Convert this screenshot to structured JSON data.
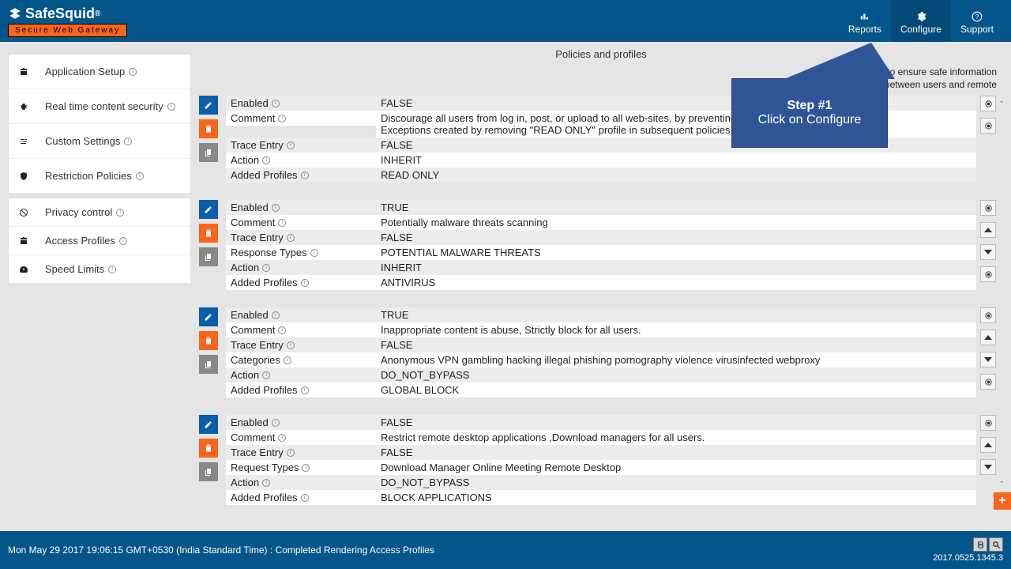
{
  "header": {
    "brand_main": "SafeSquid",
    "brand_reg": "®",
    "brand_tag": "Secure Web Gateway",
    "nav": [
      {
        "id": "reports",
        "label": "Reports"
      },
      {
        "id": "configure",
        "label": "Configure"
      },
      {
        "id": "support",
        "label": "Support"
      }
    ]
  },
  "sidebar": {
    "items": [
      {
        "id": "app-setup",
        "label": "Application Setup",
        "icon": "briefcase"
      },
      {
        "id": "realtime",
        "label": "Real time content security",
        "icon": "bug"
      },
      {
        "id": "custom",
        "label": "Custom Settings",
        "icon": "sliders"
      },
      {
        "id": "restrict",
        "label": "Restriction Policies",
        "icon": "shield"
      },
      {
        "id": "privacy",
        "label": "Privacy control",
        "icon": "ban"
      },
      {
        "id": "access",
        "label": "Access Profiles",
        "icon": "briefcase"
      },
      {
        "id": "speed",
        "label": "Speed Limits",
        "icon": "gauge"
      }
    ]
  },
  "main": {
    "title": "Policies and profiles",
    "description_l1": "Setup controls to ensure safe information",
    "description_l2": "between users and remote",
    "policies": [
      {
        "rows": [
          {
            "label": "Enabled",
            "value": "FALSE"
          },
          {
            "label": "Comment",
            "value": "Discourage all users from log in, post, or upload to all web-sites, by preventing exchange of cookies.\nExceptions created by removing \"READ ONLY\" profile in subsequent policies."
          },
          {
            "label": "Trace Entry",
            "value": "FALSE"
          },
          {
            "label": "Action",
            "value": "INHERIT"
          },
          {
            "label": "Added Profiles",
            "value": "READ ONLY"
          }
        ],
        "side": [
          "target",
          "target"
        ]
      },
      {
        "rows": [
          {
            "label": "Enabled",
            "value": "TRUE"
          },
          {
            "label": "Comment",
            "value": "Potentially malware threats scanning"
          },
          {
            "label": "Trace Entry",
            "value": "FALSE"
          },
          {
            "label": "Response Types",
            "value": "POTENTIAL MALWARE THREATS"
          },
          {
            "label": "Action",
            "value": "INHERIT"
          },
          {
            "label": "Added Profiles",
            "value": "ANTIVIRUS"
          }
        ],
        "side": [
          "target",
          "up",
          "down",
          "target"
        ]
      },
      {
        "rows": [
          {
            "label": "Enabled",
            "value": "TRUE"
          },
          {
            "label": "Comment",
            "value": "Inappropriate content is abuse, Strictly block for all users."
          },
          {
            "label": "Trace Entry",
            "value": "FALSE"
          },
          {
            "label": "Categories",
            "value": "Anonymous VPN   gambling   hacking   illegal   phishing   pornography   violence   virusinfected   webproxy"
          },
          {
            "label": "Action",
            "value": "DO_NOT_BYPASS"
          },
          {
            "label": "Added Profiles",
            "value": "GLOBAL BLOCK"
          }
        ],
        "side": [
          "target",
          "up",
          "down",
          "target"
        ]
      },
      {
        "rows": [
          {
            "label": "Enabled",
            "value": "FALSE"
          },
          {
            "label": "Comment",
            "value": "Restrict remote desktop applications ,Download managers for all users."
          },
          {
            "label": "Trace Entry",
            "value": "FALSE"
          },
          {
            "label": "Request Types",
            "value": "Download Manager   Online Meeting   Remote Desktop"
          },
          {
            "label": "Action",
            "value": "DO_NOT_BYPASS"
          },
          {
            "label": "Added Profiles",
            "value": "BLOCK APPLICATIONS"
          }
        ],
        "side": [
          "target",
          "up",
          "down"
        ]
      }
    ]
  },
  "callout": {
    "line1": "Step #1",
    "line2": "Click on Configure"
  },
  "footer": {
    "status": "Mon May 29 2017 19:06:15 GMT+0530 (India Standard Time) : Completed Rendering Access Profiles",
    "version": "2017.0525.1345.3"
  }
}
